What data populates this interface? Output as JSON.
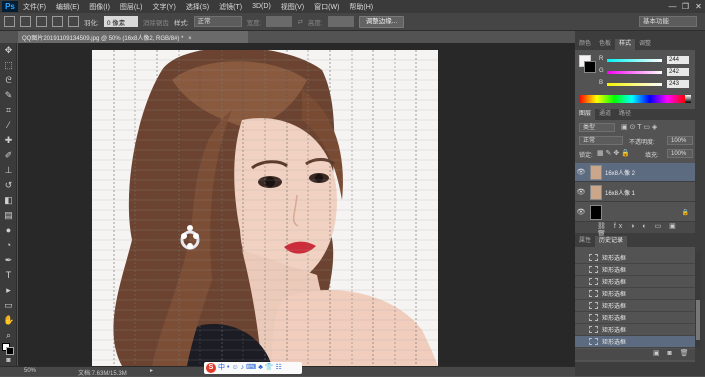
{
  "app": {
    "logo": "Ps",
    "menu": [
      "文件(F)",
      "编辑(E)",
      "图像(I)",
      "图层(L)",
      "文字(Y)",
      "选择(S)",
      "滤镜(T)",
      "3D(D)",
      "视图(V)",
      "窗口(W)",
      "帮助(H)"
    ],
    "window_controls": [
      "—",
      "❐",
      "✕"
    ]
  },
  "options": {
    "feather_label": "羽化:",
    "feather_value": "0 像素",
    "antialias_label": "消除锯齿",
    "style_label": "样式:",
    "style_value": "正常",
    "width_label": "宽度:",
    "height_label": "高度:",
    "refine_button": "调整边缘...",
    "workspace": "基本功能"
  },
  "document": {
    "tab_title": "QQ图片20191109134509.jpg @ 50% (16x8人像2, RGB/8#) *",
    "close_icon": "×"
  },
  "status": {
    "zoom": "50%",
    "doc_info": "文档:7.63M/15.3M"
  },
  "ime_bar": {
    "brand": "S",
    "items": [
      "中",
      "•",
      "☺",
      "♪",
      "⌨",
      "♣",
      "👕",
      "☷"
    ]
  },
  "color_panel": {
    "tabs": [
      "颜色",
      "色板",
      "样式",
      "调整"
    ],
    "active_tab": 2,
    "channels": [
      {
        "label": "R",
        "value": "244"
      },
      {
        "label": "G",
        "value": "242"
      },
      {
        "label": "B",
        "value": "243"
      }
    ]
  },
  "layers_panel": {
    "tabs": [
      "图层",
      "通道",
      "路径"
    ],
    "kind_filter": "类型",
    "blend_mode": "正常",
    "opacity_label": "不透明度:",
    "opacity_value": "100%",
    "lock_label": "锁定:",
    "fill_label": "填充:",
    "fill_value": "100%",
    "layers": [
      {
        "name": "16x8人像 2"
      },
      {
        "name": "16x8人像 1"
      },
      {
        "name": ""
      }
    ]
  },
  "history_panel": {
    "tabs": [
      "属性",
      "历史记录"
    ],
    "active_tab": 1,
    "items": [
      "矩形选框",
      "矩形选框",
      "矩形选框",
      "矩形选框",
      "矩形选框",
      "矩形选框",
      "矩形选框",
      "矩形选框",
      "矩形选框"
    ]
  }
}
